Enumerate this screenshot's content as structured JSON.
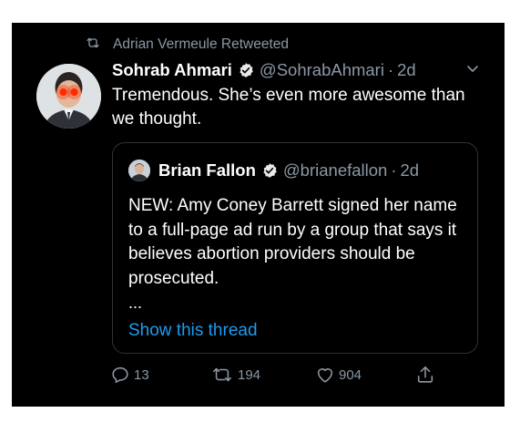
{
  "retweet": {
    "icon": "retweet-icon",
    "label": "Adrian Vermeule Retweeted"
  },
  "tweet": {
    "author_name": "Sohrab Ahmari",
    "author_handle": "@SohrabAhmari",
    "separator": "·",
    "time": "2d",
    "text": "Tremendous. She’s even more awesome than we thought."
  },
  "quote": {
    "author_name": "Brian Fallon",
    "author_handle": "@brianefallon",
    "separator": "·",
    "time": "2d",
    "text": "NEW: Amy Coney Barrett signed her name to a full-page ad run by a group that says it believes abortion providers should be prosecuted.",
    "ellipsis": "...",
    "show_thread": "Show this thread"
  },
  "actions": {
    "reply_count": "13",
    "retweet_count": "194",
    "like_count": "904"
  },
  "colors": {
    "background": "#000000",
    "text": "#ffffff",
    "muted": "#8b98a5",
    "link": "#1d9bf0",
    "border": "#2f3336"
  }
}
